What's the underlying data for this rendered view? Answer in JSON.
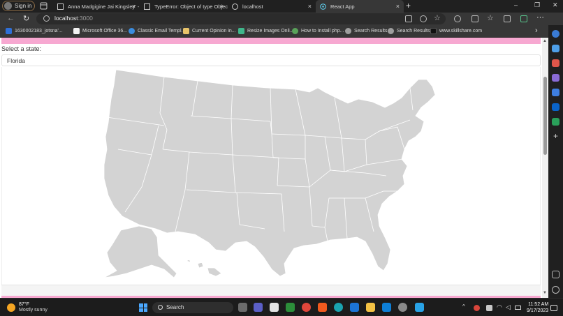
{
  "browser": {
    "signin_label": "Sign in",
    "tabs": [
      {
        "label": "Anna Madgigine Jai Kingsley' - W",
        "close": "×"
      },
      {
        "label": "TypeError: Object of type Object",
        "close": "×"
      },
      {
        "label": "localhost",
        "close": "×"
      },
      {
        "label": "React App",
        "close": "×"
      }
    ],
    "new_tab": "+",
    "window_controls": {
      "minimize": "–",
      "maximize": "❐",
      "close": "✕"
    },
    "address": {
      "host": "localhost",
      "port": ":3000"
    },
    "favorites": [
      "1630002183_jotsna'...",
      "Microsoft Office 36...",
      "Classic Email Templ...",
      "Current Opinion in...",
      "Resize Images Onli...",
      "How to Install php...",
      "Search Results",
      "Search Results",
      "www.skillshare.com"
    ],
    "favorites_more": "›"
  },
  "page": {
    "select_label": "Select a state:",
    "selected_state": "Florida",
    "map_fill": "#d3d3d3",
    "map_stroke": "#ffffff",
    "accent": "#f7a8d1"
  },
  "taskbar": {
    "weather_temp": "87°F",
    "weather_desc": "Mostly sunny",
    "search_label": "Search",
    "time": "11:52 AM",
    "date": "9/17/2023",
    "tray_chevron": "^"
  }
}
